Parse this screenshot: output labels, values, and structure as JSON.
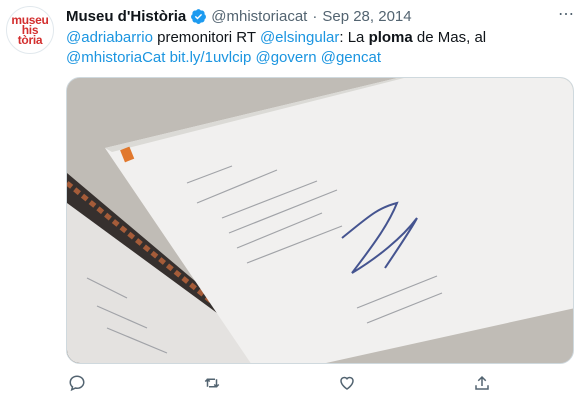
{
  "tweet": {
    "author": {
      "avatar_text": [
        "museu",
        "his",
        "tòria"
      ],
      "name": "Museu d'Història",
      "handle": "@mhistoriacat",
      "separator": "·",
      "date": "Sep 28, 2014"
    },
    "text": {
      "mention_1": "@adriabarrio",
      "part_1": " premonitori RT ",
      "mention_2": "@elsingular",
      "part_2": ": La ",
      "bold": "ploma",
      "part_3": " de Mas, al",
      "mention_3": "@mhistoriaCat",
      "link": "bit.ly/1uvlcip",
      "mention_4": "@govern",
      "mention_5": "@gencat"
    },
    "more_icon": "⋯",
    "actions": [
      "reply-icon",
      "retweet-icon",
      "like-icon",
      "share-icon"
    ]
  },
  "colors": {
    "link": "#1b95e0",
    "text": "#0f1419",
    "muted": "#536471",
    "verified": "#1d9bf0",
    "avatar_red": "#d32f2f"
  }
}
